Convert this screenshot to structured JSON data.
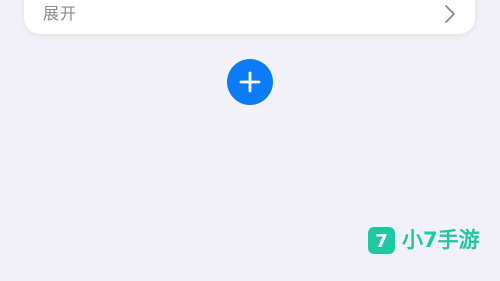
{
  "expand_card": {
    "label": "展开"
  },
  "add_button": {
    "icon": "plus-icon"
  },
  "watermark": {
    "logo_text": "7",
    "brand": "小7手游"
  },
  "colors": {
    "background": "#f1f1f7",
    "card": "#ffffff",
    "label_gray": "#8b8b90",
    "accent_blue": "#0a7cfa",
    "watermark_green": "#1fc8a3"
  }
}
